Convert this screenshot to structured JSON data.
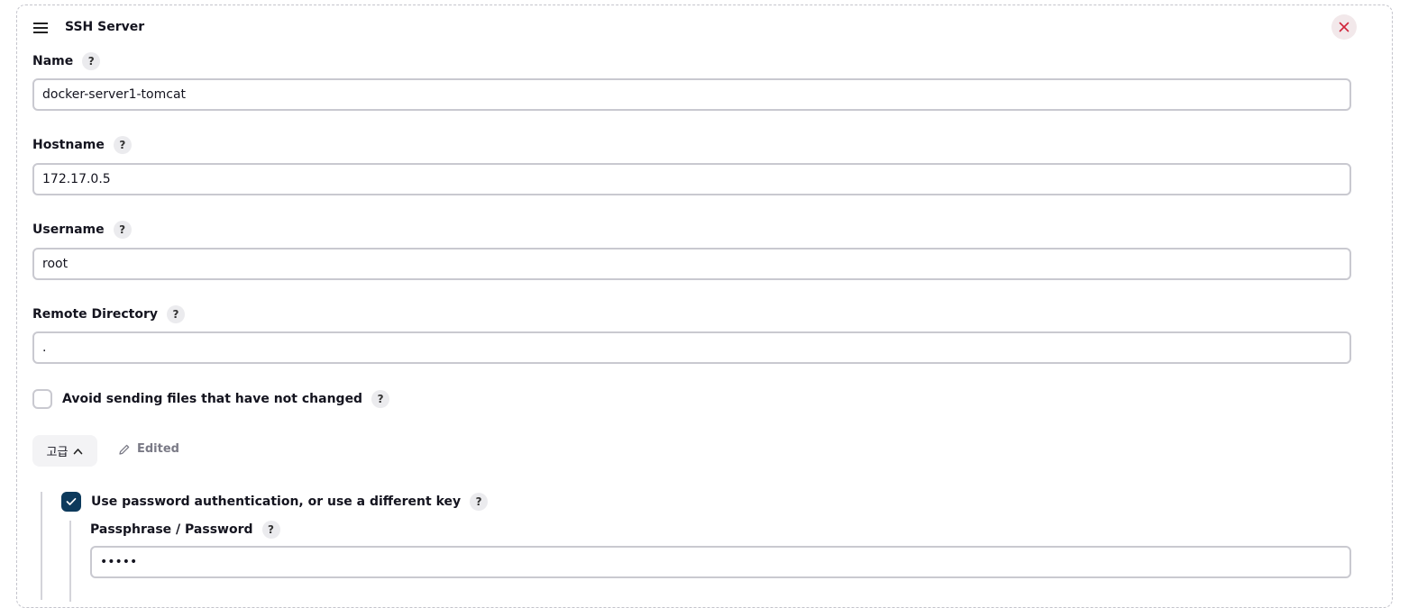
{
  "card": {
    "title": "SSH Server",
    "drag_icon": "hamburger-menu-icon",
    "close_icon": "close-icon",
    "close_color": "#d0243a"
  },
  "fields": {
    "name": {
      "label": "Name",
      "value": "docker-server1-tomcat"
    },
    "hostname": {
      "label": "Hostname",
      "value": "172.17.0.5"
    },
    "username": {
      "label": "Username",
      "value": "root"
    },
    "remote_directory": {
      "label": "Remote Directory",
      "value": "."
    }
  },
  "help_text": "?",
  "avoid_sending": {
    "label": "Avoid sending files that have not changed",
    "checked": false
  },
  "advanced": {
    "label": "고급",
    "icon": "chevron-up-icon",
    "edited_label": "Edited",
    "edited_icon": "pencil-icon"
  },
  "password_auth": {
    "label": "Use password authentication, or use a different key",
    "checked": true,
    "accent": "#0d3a5c"
  },
  "passphrase": {
    "label": "Passphrase / Password",
    "value": "•••••"
  }
}
